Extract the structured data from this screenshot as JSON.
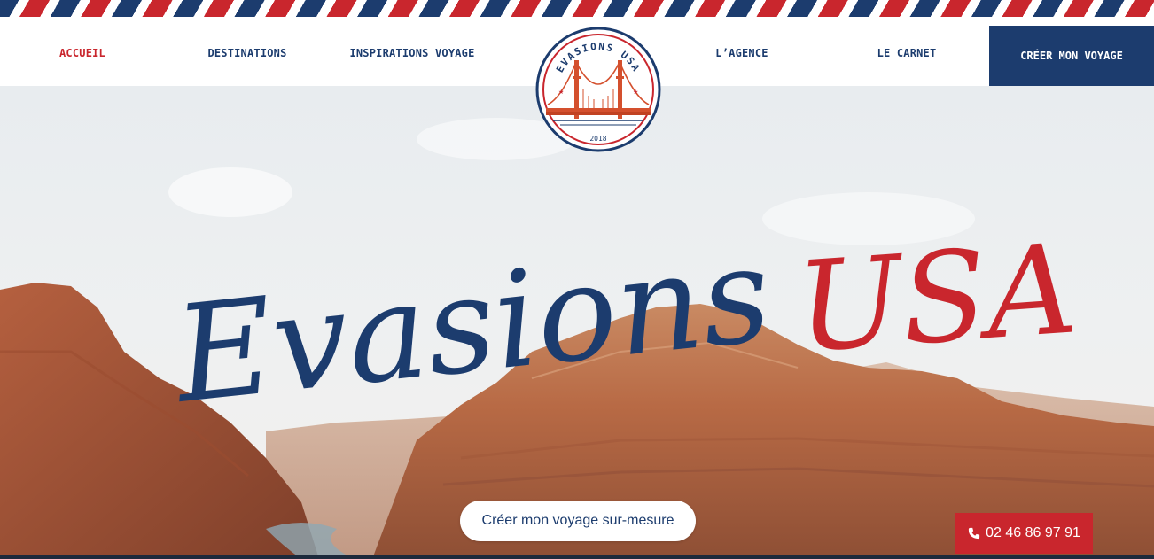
{
  "nav": {
    "items": [
      {
        "label": "ACCUEIL",
        "active": true
      },
      {
        "label": "DESTINATIONS",
        "active": false
      },
      {
        "label": "INSPIRATIONS VOYAGE",
        "active": false
      },
      {
        "label": "L’AGENCE",
        "active": false
      },
      {
        "label": "LE CARNET",
        "active": false
      }
    ],
    "cta_label": "CRÉER MON VOYAGE"
  },
  "logo": {
    "top_text": "EVASIONS USA",
    "year": "2018",
    "icon": "golden-gate-bridge-icon"
  },
  "hero": {
    "title_script": "Evasions",
    "title_accent": "USA",
    "cta_label": "Créer mon voyage sur-mesure",
    "phone": "02 46 86 97 91",
    "phone_icon": "phone-icon"
  },
  "colors": {
    "navy": "#1c3c6e",
    "red": "#c9262d",
    "white": "#ffffff"
  }
}
